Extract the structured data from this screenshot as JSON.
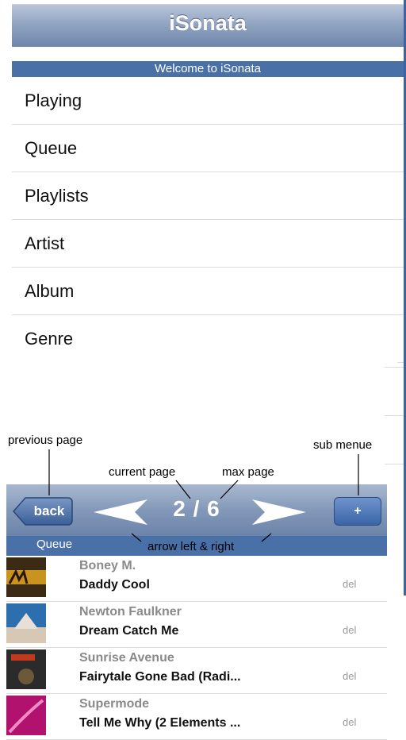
{
  "app": {
    "title": "iSonata",
    "welcome": "Welcome to iSonata",
    "menu": [
      "Playing",
      "Queue",
      "Playlists",
      "Artist",
      "Album",
      "Genre"
    ]
  },
  "player": {
    "back_label": "back",
    "page_current": "2",
    "page_sep": "/",
    "page_max": "6",
    "sub_menu_label": "+",
    "section": "Queue",
    "songs": [
      {
        "artist": "Boney M.",
        "track": "Daddy Cool",
        "action": "del",
        "art_colors": [
          "#3b2a14",
          "#c8931e"
        ]
      },
      {
        "artist": "Newton Faulkner",
        "track": "Dream Catch Me",
        "action": "del",
        "art_colors": [
          "#2d6fae",
          "#d6c8b4"
        ]
      },
      {
        "artist": "Sunrise Avenue",
        "track": "Fairytale Gone Bad (Radi...",
        "action": "del",
        "art_colors": [
          "#2b2b2b",
          "#c23a1e"
        ]
      },
      {
        "artist": "Supermode",
        "track": "Tell Me Why (2 Elements ...",
        "action": "del",
        "art_colors": [
          "#b0126e",
          "#f28ac8"
        ]
      }
    ]
  },
  "annotations": {
    "previous_page": "previous page",
    "current_page": "current page",
    "max_page": "max page",
    "sub_menu": "sub menue",
    "arrows": "arrow left & right"
  },
  "colors": {
    "nav_gradient": "#8398b9",
    "subbar": "#4a70a8",
    "button": "#3a65a8"
  }
}
